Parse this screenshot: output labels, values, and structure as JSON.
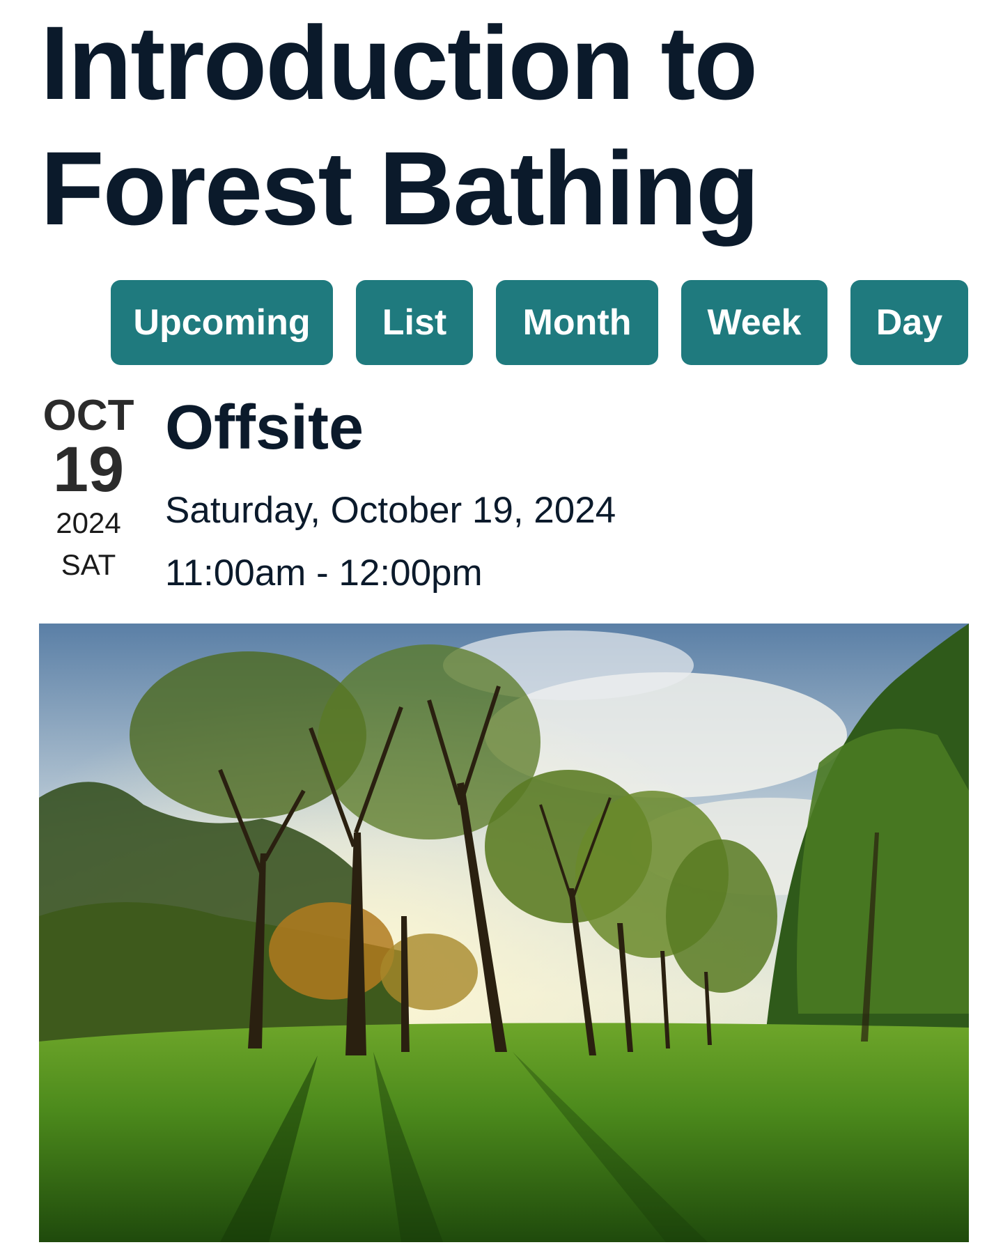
{
  "event": {
    "title": "Introduction to Forest Bathing",
    "venue": "Offsite",
    "date_text": "Saturday, October 19, 2024",
    "time_text": "11:00am - 12:00pm"
  },
  "date_badge": {
    "month": "OCT",
    "day": "19",
    "year": "2024",
    "weekday": "SAT"
  },
  "view_nav": {
    "upcoming": "Upcoming",
    "list": "List",
    "month": "Month",
    "week": "Week",
    "day": "Day"
  },
  "colors": {
    "accent": "#1f7a7e",
    "title": "#0b1a2b"
  }
}
